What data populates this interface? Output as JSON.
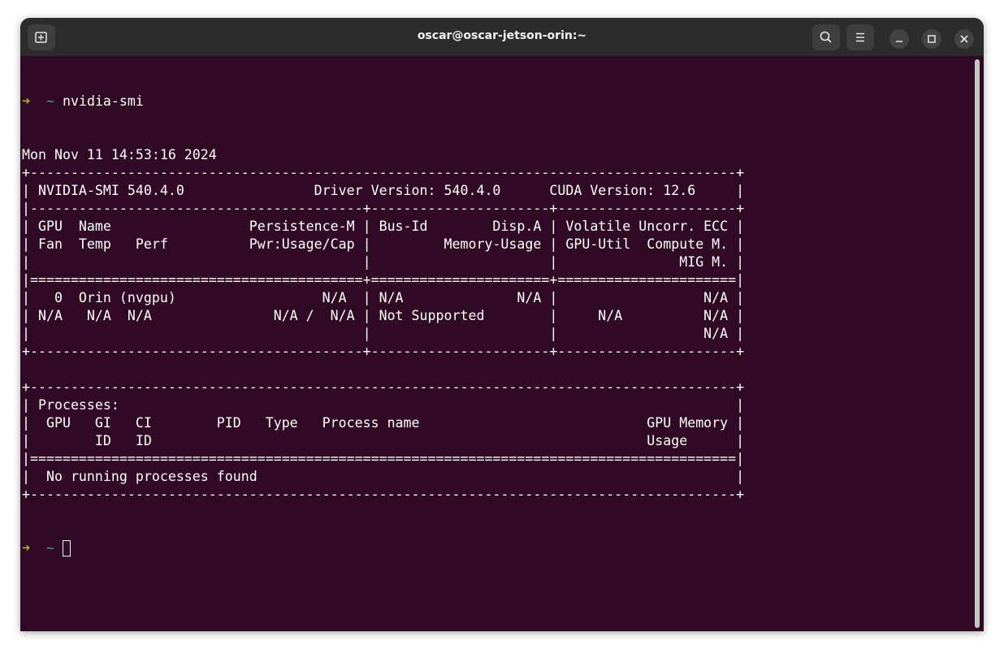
{
  "window": {
    "title": "oscar@oscar-jetson-orin:~"
  },
  "titlebar": {
    "new_tab_icon": "new-tab-icon",
    "search_icon": "search-icon",
    "menu_icon": "hamburger-menu-icon",
    "minimize_icon": "minimize-icon",
    "maximize_icon": "maximize-icon",
    "close_icon": "close-icon"
  },
  "prompt": {
    "arrow": "➜",
    "cwd": "~",
    "arrow_color": "#b5b629",
    "cwd_color": "#32aaaa"
  },
  "command": "nvidia-smi",
  "output_lines": [
    "Mon Nov 11 14:53:16 2024",
    "+---------------------------------------------------------------------------------------+",
    "| NVIDIA-SMI 540.4.0                Driver Version: 540.4.0      CUDA Version: 12.6     |",
    "|-----------------------------------------+----------------------+----------------------+",
    "| GPU  Name                 Persistence-M | Bus-Id        Disp.A | Volatile Uncorr. ECC |",
    "| Fan  Temp   Perf          Pwr:Usage/Cap |         Memory-Usage | GPU-Util  Compute M. |",
    "|                                         |                      |               MIG M. |",
    "|=========================================+======================+======================|",
    "|   0  Orin (nvgpu)                  N/A  | N/A              N/A |                  N/A |",
    "| N/A   N/A  N/A               N/A /  N/A | Not Supported        |     N/A          N/A |",
    "|                                         |                      |                  N/A |",
    "+-----------------------------------------+----------------------+----------------------+",
    "",
    "+---------------------------------------------------------------------------------------+",
    "| Processes:                                                                            |",
    "|  GPU   GI   CI        PID   Type   Process name                            GPU Memory |",
    "|        ID   ID                                                             Usage      |",
    "|=======================================================================================|",
    "|  No running processes found                                                           |",
    "+---------------------------------------------------------------------------------------+"
  ],
  "colors": {
    "terminal_bg": "#300a24",
    "titlebar_bg": "#2c2c2c",
    "text": "#ffffff"
  }
}
